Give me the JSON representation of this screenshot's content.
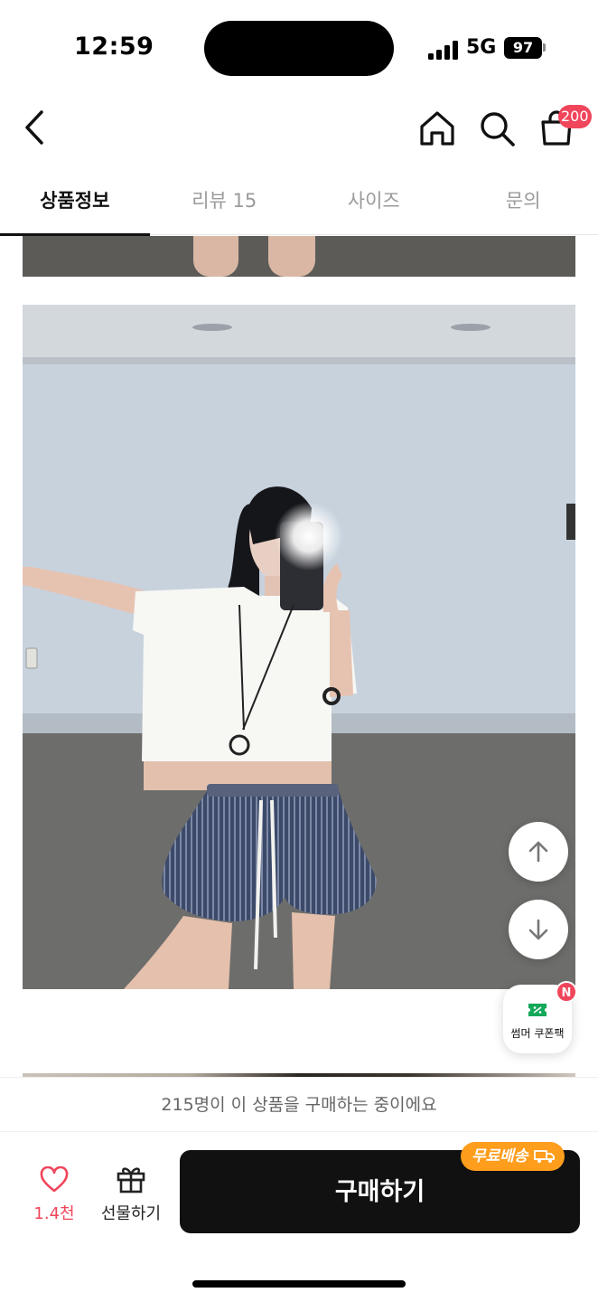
{
  "status_bar": {
    "time": "12:59",
    "network": "5G",
    "battery": "97"
  },
  "header": {
    "back_icon": "chevron-left-icon",
    "icons": [
      "home-icon",
      "search-icon",
      "shopping-bag-icon"
    ],
    "cart_count": "200"
  },
  "tabs": [
    {
      "label": "상품정보",
      "active": true
    },
    {
      "label": "리뷰 15",
      "active": false
    },
    {
      "label": "사이즈",
      "active": false
    },
    {
      "label": "문의",
      "active": false
    }
  ],
  "floating": {
    "scroll_up_icon": "arrow-up-icon",
    "scroll_down_icon": "arrow-down-icon",
    "coupon_label": "썸머 쿠폰팩",
    "coupon_badge": "N"
  },
  "purchase": {
    "buyers_text": "215명이 이 상품을 구매하는 중이에요",
    "like_count": "1.4천",
    "gift_label": "선물하기",
    "buy_label": "구매하기",
    "free_shipping_label": "무료배송"
  },
  "colors": {
    "accent": "#f0455b",
    "buy_button": "#111111",
    "free_shipping": "#ff9d1c"
  }
}
